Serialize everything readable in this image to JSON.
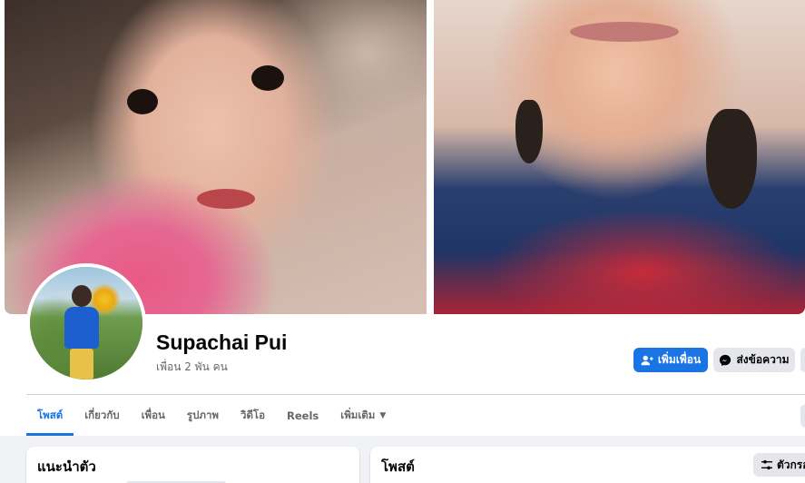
{
  "profile": {
    "name": "Supachai Pui",
    "friend_count": "เพื่อน 2 พัน คน"
  },
  "actions": {
    "add_friend_label": "เพิ่มเพื่อน",
    "message_label": "ส่งข้อความ"
  },
  "tabs": [
    {
      "label": "โพสต์",
      "active": true
    },
    {
      "label": "เกี่ยวกับ",
      "active": false
    },
    {
      "label": "เพื่อน",
      "active": false
    },
    {
      "label": "รูปภาพ",
      "active": false
    },
    {
      "label": "วิดีโอ",
      "active": false
    },
    {
      "label": "Reels",
      "active": false
    },
    {
      "label": "เพิ่มเติม",
      "active": false
    }
  ],
  "intro_card": {
    "title": "แนะนำตัว"
  },
  "posts_card": {
    "title": "โพสต์",
    "filter_label": "ตัวกรอง"
  },
  "icons": {
    "add_friend": "person-add-icon",
    "messenger": "messenger-icon",
    "more_caret": "caret-down-icon",
    "filter": "sliders-icon"
  },
  "colors": {
    "accent": "#1b74e4",
    "secondary_button": "#e4e6eb",
    "text_primary": "#050505",
    "text_secondary": "#65676b",
    "page_background": "#f0f2f5"
  }
}
